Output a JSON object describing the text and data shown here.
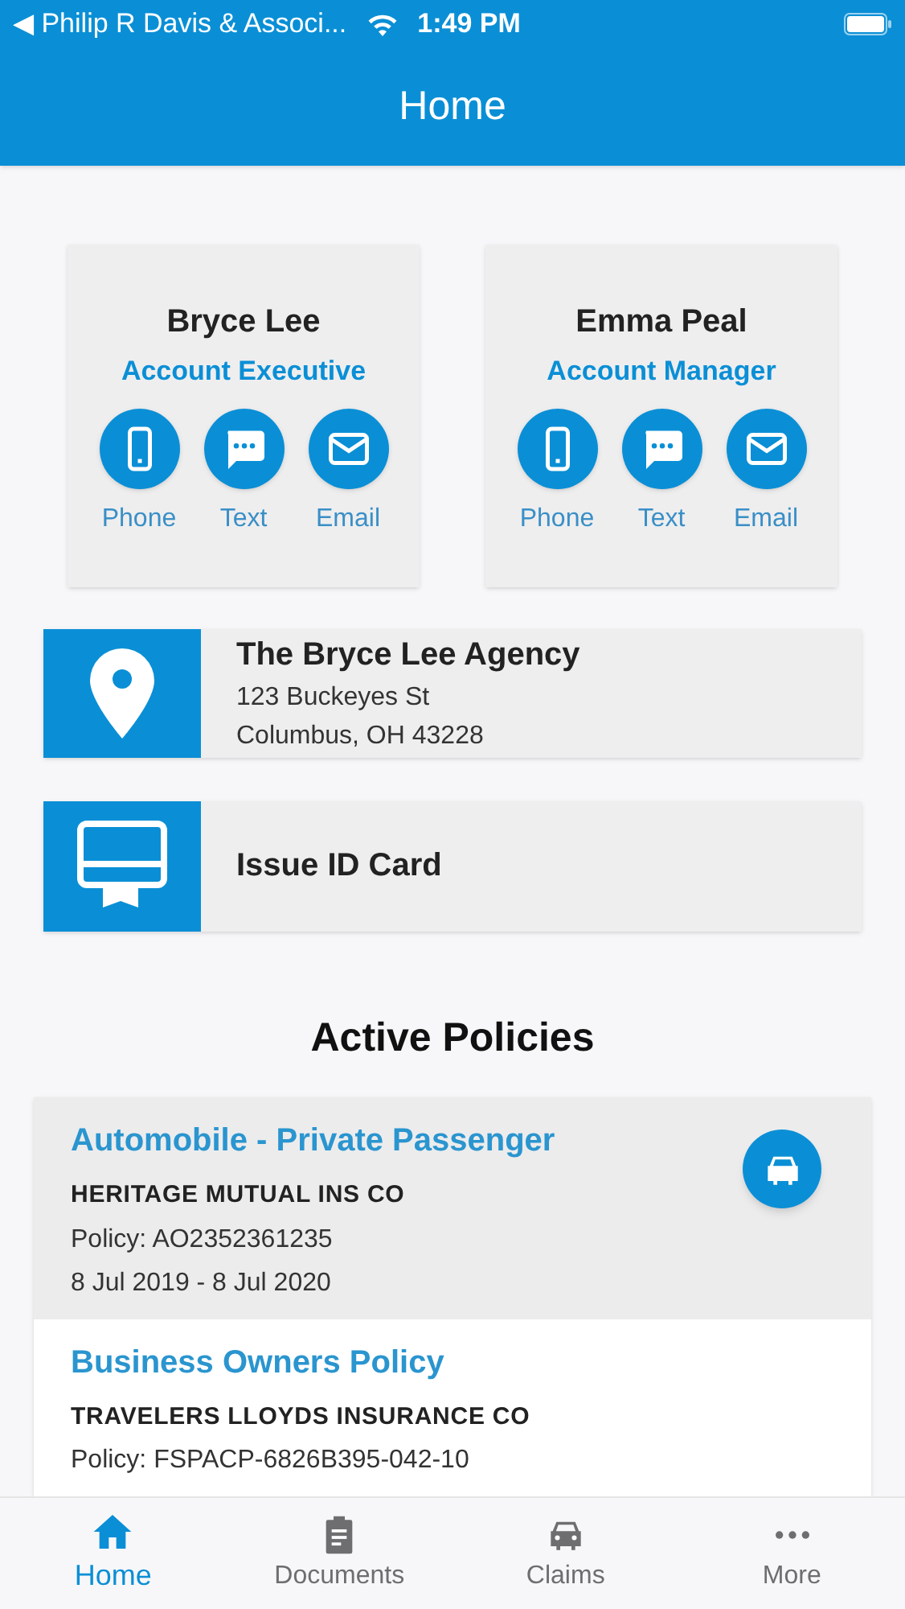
{
  "status_bar": {
    "back_label": "◀ Philip R Davis & Associ...",
    "time": "1:49 PM"
  },
  "header": {
    "title": "Home"
  },
  "contacts": [
    {
      "name": "Bryce Lee",
      "role": "Account Executive",
      "actions": [
        {
          "kind": "phone",
          "label": "Phone"
        },
        {
          "kind": "text",
          "label": "Text"
        },
        {
          "kind": "email",
          "label": "Email"
        }
      ]
    },
    {
      "name": "Emma Peal",
      "role": "Account Manager",
      "actions": [
        {
          "kind": "phone",
          "label": "Phone"
        },
        {
          "kind": "text",
          "label": "Text"
        },
        {
          "kind": "email",
          "label": "Email"
        }
      ]
    }
  ],
  "agency": {
    "name": "The Bryce Lee Agency",
    "address_lines": [
      "123 Buckeyes St",
      "Columbus, OH 43228"
    ]
  },
  "id_card": {
    "label": "Issue ID Card"
  },
  "policies_title": "Active Policies",
  "policies": [
    {
      "title": "Automobile - Private Passenger",
      "carrier": "HERITAGE MUTUAL INS CO",
      "policy": "Policy: AO2352361235",
      "dates": "8 Jul 2019 - 8 Jul 2020",
      "kind": "auto",
      "selected": true
    },
    {
      "title": "Business Owners Policy",
      "carrier": "TRAVELERS LLOYDS INSURANCE CO",
      "policy": "Policy: FSPACP-6826B395-042-10",
      "selected": false
    }
  ],
  "tabs": [
    {
      "kind": "home",
      "label": "Home",
      "selected": true
    },
    {
      "kind": "documents",
      "label": "Documents",
      "selected": false
    },
    {
      "kind": "claims",
      "label": "Claims",
      "selected": false
    },
    {
      "kind": "more",
      "label": "More",
      "selected": false
    }
  ]
}
